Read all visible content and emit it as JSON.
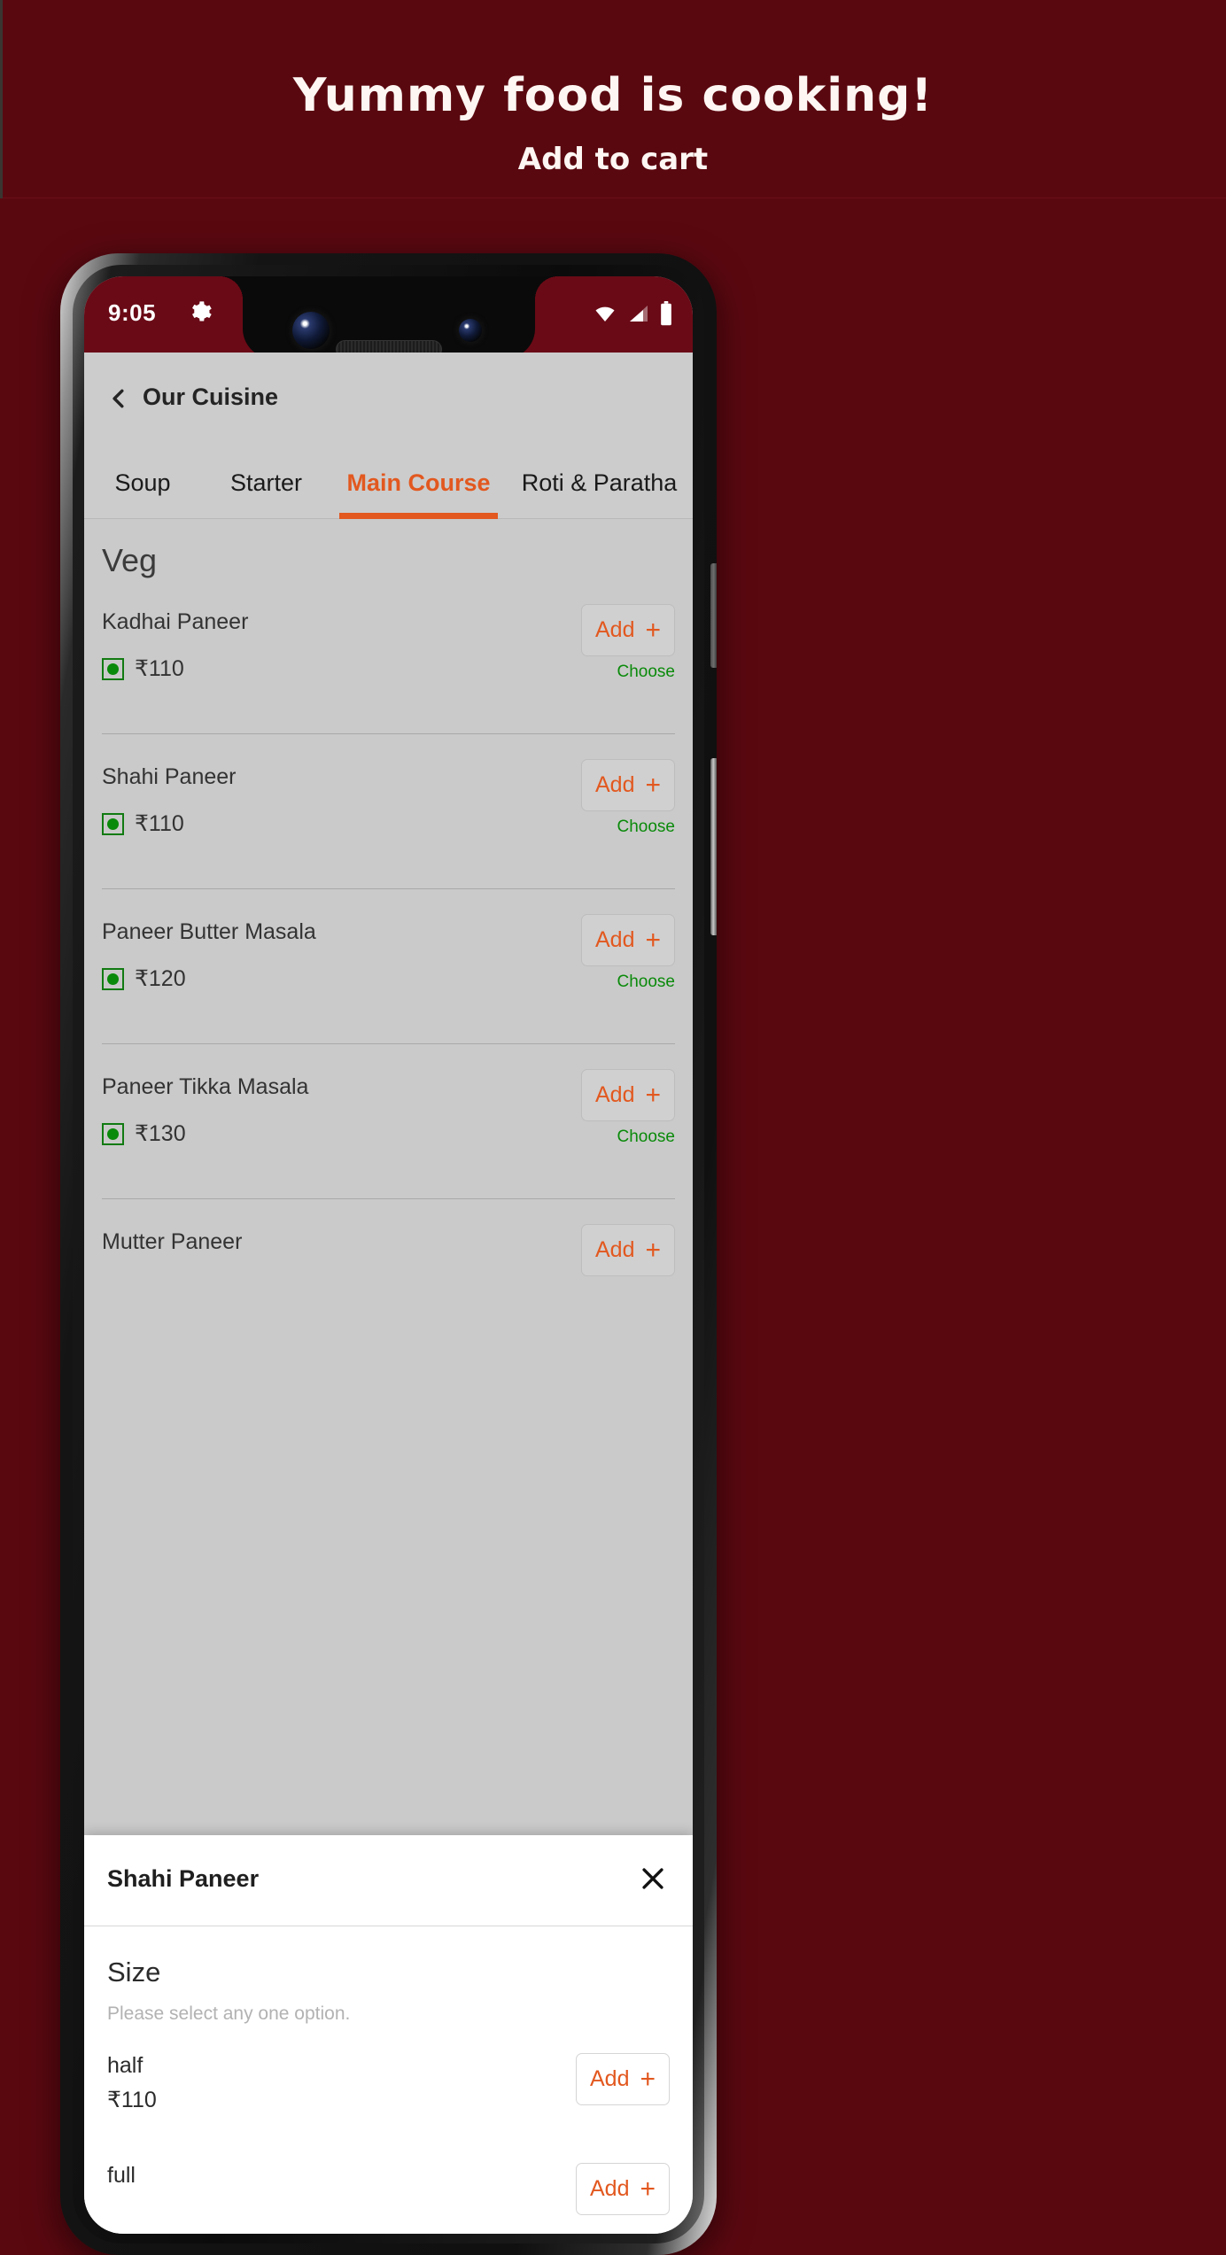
{
  "promo": {
    "title": "Yummy food is cooking!",
    "subtitle": "Add to cart"
  },
  "colors": {
    "background": "#5a0810",
    "accent": "#e2581f",
    "veg_green": "#0a8a0a",
    "status_bar": "#6a0a16",
    "screen_bg": "#cacaca"
  },
  "status_bar": {
    "time": "9:05",
    "gear_icon": "gear-icon",
    "wifi_icon": "wifi-icon",
    "signal_icon": "signal-icon",
    "battery_icon": "battery-icon"
  },
  "app_bar": {
    "back_icon": "back-chevron-icon",
    "title": "Our Cuisine"
  },
  "tabs": [
    {
      "label": "Soup",
      "active": false
    },
    {
      "label": "Starter",
      "active": false
    },
    {
      "label": "Main Course",
      "active": true
    },
    {
      "label": "Roti & Paratha",
      "active": false
    }
  ],
  "menu": {
    "section_title": "Veg",
    "add_label": "Add",
    "plus_icon": "plus-icon",
    "choose_label": "Choose",
    "veg_icon": "veg-indicator-icon",
    "items": [
      {
        "name": "Kadhai Paneer",
        "price": "₹110"
      },
      {
        "name": "Shahi Paneer",
        "price": "₹110"
      },
      {
        "name": "Paneer Butter Masala",
        "price": "₹120"
      },
      {
        "name": "Paneer Tikka Masala",
        "price": "₹130"
      },
      {
        "name": "Mutter Paneer",
        "price": ""
      }
    ]
  },
  "sheet": {
    "title": "Shahi Paneer",
    "close_icon": "close-icon",
    "section_title": "Size",
    "section_hint": "Please select any one option.",
    "add_label": "Add",
    "plus_icon": "plus-icon",
    "options": [
      {
        "label": "half",
        "price": "₹110"
      },
      {
        "label": "full",
        "price": ""
      }
    ]
  }
}
